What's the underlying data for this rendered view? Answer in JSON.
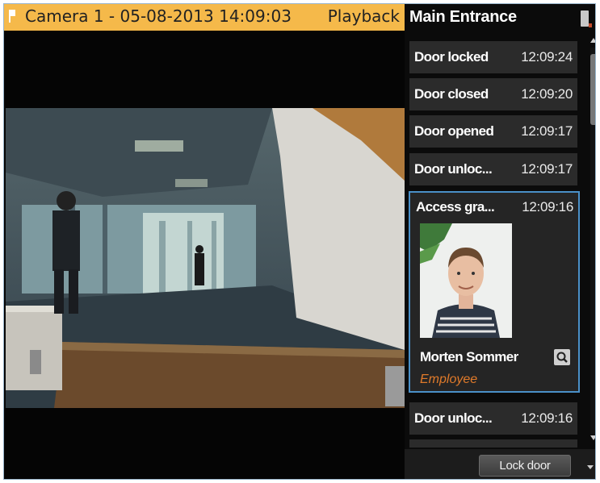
{
  "camera": {
    "title": "Camera 1 - 05-08-2013 14:09:03",
    "mode": "Playback"
  },
  "panel": {
    "title": "Main Entrance"
  },
  "events": [
    {
      "label": "Door locked",
      "time": "12:09:24"
    },
    {
      "label": "Door closed",
      "time": "12:09:20"
    },
    {
      "label": "Door opened",
      "time": "12:09:17"
    },
    {
      "label": "Door unloc...",
      "time": "12:09:17"
    },
    {
      "label": "Access gra...",
      "time": "12:09:16",
      "person": {
        "name": "Morten Sommer",
        "role": "Employee"
      }
    },
    {
      "label": "Door unloc...",
      "time": "12:09:16"
    }
  ],
  "actions": {
    "lock_door": "Lock door"
  },
  "colors": {
    "camera_bar": "#f5b94a",
    "selected_border": "#4a90c8",
    "role_text": "#e07a2a"
  },
  "icons": [
    "camera-flag-icon",
    "door-icon",
    "search-icon",
    "chevron-down-icon",
    "scroll-up-icon",
    "scroll-down-icon"
  ]
}
